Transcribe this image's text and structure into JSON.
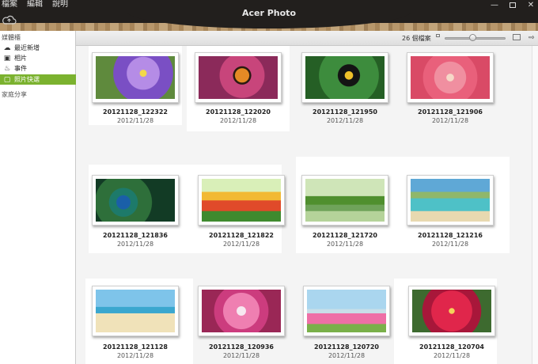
{
  "window": {
    "title": "Acer Photo",
    "menu": [
      "檔案",
      "編輯",
      "說明"
    ],
    "controls": [
      "minimize",
      "maximize",
      "close"
    ]
  },
  "toolbar": {
    "file_count": "26 個檔案",
    "zoom_level": 0.42,
    "icons": [
      "small-thumbnail-icon",
      "zoom-slider",
      "large-thumbnail-icon",
      "export-icon"
    ]
  },
  "sidebar": {
    "section_media": "媒體櫃",
    "items": [
      {
        "label": "最近新增",
        "icon": "recent-icon"
      },
      {
        "label": "相片",
        "icon": "photos-icon"
      },
      {
        "label": "事件",
        "icon": "events-icon"
      },
      {
        "label": "照片快選",
        "icon": "quick-select-icon",
        "active": true
      }
    ],
    "section_share": "家庭分享"
  },
  "photos": [
    {
      "name": "20121128_122322",
      "date": "2012/11/28",
      "icon": "purple-flowers"
    },
    {
      "name": "20121128_122020",
      "date": "2012/11/28",
      "icon": "butterfly"
    },
    {
      "name": "20121128_121950",
      "date": "2012/11/28",
      "icon": "toucan"
    },
    {
      "name": "20121128_121906",
      "date": "2012/11/28",
      "icon": "pink-flower"
    },
    {
      "name": "20121128_121836",
      "date": "2012/11/28",
      "icon": "peacock"
    },
    {
      "name": "20121128_121822",
      "date": "2012/11/28",
      "icon": "tulips"
    },
    {
      "name": "20121128_121720",
      "date": "2012/11/28",
      "icon": "bee-eaters"
    },
    {
      "name": "20121128_121216",
      "date": "2012/11/28",
      "icon": "longtail-boat"
    },
    {
      "name": "20121128_121128",
      "date": "2012/11/28",
      "icon": "beach-umbrella"
    },
    {
      "name": "20121128_120936",
      "date": "2012/11/28",
      "icon": "lilies"
    },
    {
      "name": "20121128_120720",
      "date": "2012/11/28",
      "icon": "cosmos-flowers"
    },
    {
      "name": "20121128_120704",
      "date": "2012/11/28",
      "icon": "red-dahlia"
    }
  ]
}
